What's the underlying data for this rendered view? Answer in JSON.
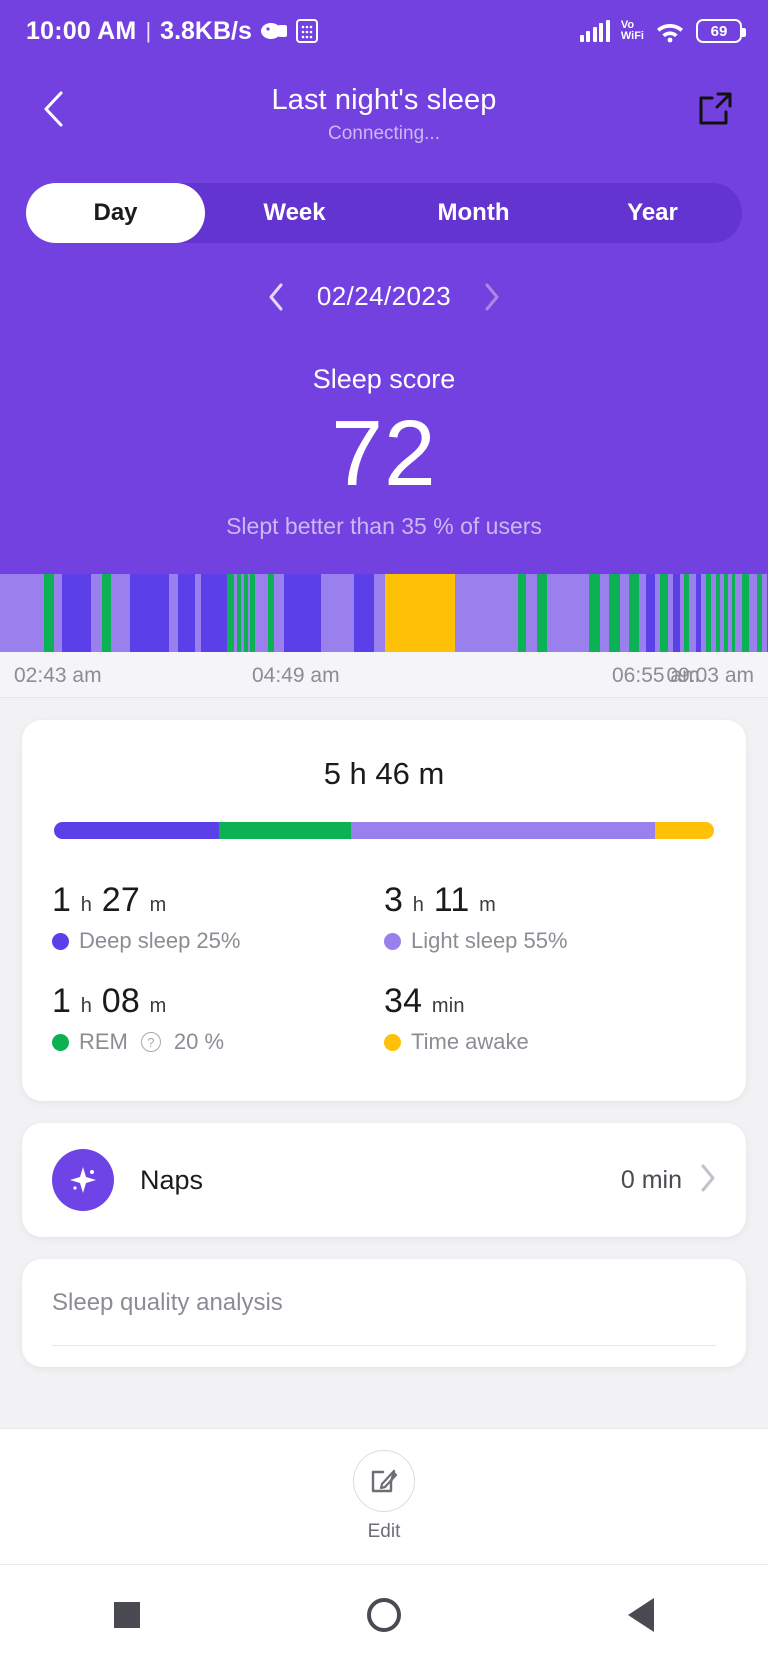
{
  "status_bar": {
    "time": "10:00 AM",
    "separator": "|",
    "network_speed": "3.8KB/s",
    "volte_line1": "Vo",
    "volte_line2": "WiFi",
    "battery_percent": "69"
  },
  "header": {
    "title": "Last night's sleep",
    "subtitle": "Connecting..."
  },
  "tabs": [
    {
      "label": "Day",
      "active": true
    },
    {
      "label": "Week",
      "active": false
    },
    {
      "label": "Month",
      "active": false
    },
    {
      "label": "Year",
      "active": false
    }
  ],
  "date_nav": {
    "prev": "‹",
    "date": "02/24/2023",
    "next": "›"
  },
  "score": {
    "label": "Sleep score",
    "value": "72",
    "comparison": "Slept better than 35 % of users"
  },
  "colors": {
    "header_purple": "#7341e0",
    "tab_track": "#6334cf",
    "deep": "#5b3fe8",
    "rem": "#0bb152",
    "light": "#9a80ec",
    "awake": "#ffc107",
    "text_muted": "#8c8c94"
  },
  "hypnogram": {
    "time_labels": [
      "02:43 am",
      "04:49 am",
      "06:55 am",
      "09:03 am"
    ],
    "segments": [
      {
        "stage": "light",
        "width": 5.2
      },
      {
        "stage": "rem",
        "width": 1.1
      },
      {
        "stage": "light",
        "width": 1.0
      },
      {
        "stage": "deep",
        "width": 3.4
      },
      {
        "stage": "light",
        "width": 1.3
      },
      {
        "stage": "rem",
        "width": 1.1
      },
      {
        "stage": "light",
        "width": 2.2
      },
      {
        "stage": "deep",
        "width": 4.6
      },
      {
        "stage": "light",
        "width": 1.0
      },
      {
        "stage": "deep",
        "width": 2.1
      },
      {
        "stage": "light",
        "width": 0.7
      },
      {
        "stage": "deep",
        "width": 3.0
      },
      {
        "stage": "rem",
        "width": 0.8
      },
      {
        "stage": "light",
        "width": 0.4
      },
      {
        "stage": "rem",
        "width": 0.5
      },
      {
        "stage": "light",
        "width": 0.3
      },
      {
        "stage": "rem",
        "width": 0.5
      },
      {
        "stage": "light",
        "width": 0.3
      },
      {
        "stage": "rem",
        "width": 0.5
      },
      {
        "stage": "light",
        "width": 1.6
      },
      {
        "stage": "rem",
        "width": 0.7
      },
      {
        "stage": "light",
        "width": 1.2
      },
      {
        "stage": "deep",
        "width": 4.3
      },
      {
        "stage": "light",
        "width": 3.9
      },
      {
        "stage": "deep",
        "width": 2.4
      },
      {
        "stage": "light",
        "width": 1.2
      },
      {
        "stage": "awake",
        "width": 8.3
      },
      {
        "stage": "light",
        "width": 7.4
      },
      {
        "stage": "rem",
        "width": 1.0
      },
      {
        "stage": "light",
        "width": 1.2
      },
      {
        "stage": "rem",
        "width": 1.2
      },
      {
        "stage": "light",
        "width": 5.0
      },
      {
        "stage": "rem",
        "width": 1.2
      },
      {
        "stage": "light",
        "width": 1.1
      },
      {
        "stage": "rem",
        "width": 1.3
      },
      {
        "stage": "light",
        "width": 1.1
      },
      {
        "stage": "rem",
        "width": 1.2
      },
      {
        "stage": "light",
        "width": 0.8
      },
      {
        "stage": "deep",
        "width": 1.0
      },
      {
        "stage": "light",
        "width": 0.6
      },
      {
        "stage": "rem",
        "width": 1.0
      },
      {
        "stage": "light",
        "width": 0.6
      },
      {
        "stage": "deep",
        "width": 0.8
      },
      {
        "stage": "light",
        "width": 0.5
      },
      {
        "stage": "rem",
        "width": 0.6
      },
      {
        "stage": "light",
        "width": 0.8
      },
      {
        "stage": "deep",
        "width": 0.6
      },
      {
        "stage": "light",
        "width": 0.6
      },
      {
        "stage": "rem",
        "width": 0.5
      },
      {
        "stage": "light",
        "width": 0.6
      },
      {
        "stage": "rem",
        "width": 0.5
      },
      {
        "stage": "light",
        "width": 0.5
      },
      {
        "stage": "rem",
        "width": 0.4
      },
      {
        "stage": "light",
        "width": 0.5
      },
      {
        "stage": "rem",
        "width": 0.4
      },
      {
        "stage": "light",
        "width": 0.8
      },
      {
        "stage": "rem",
        "width": 0.8
      },
      {
        "stage": "light",
        "width": 1.0
      },
      {
        "stage": "rem",
        "width": 0.5
      },
      {
        "stage": "light",
        "width": 0.7
      }
    ]
  },
  "duration_card": {
    "total": "5 h 46 m",
    "stack": [
      {
        "stage": "deep",
        "percent": 25
      },
      {
        "stage": "rem",
        "percent": 20
      },
      {
        "stage": "light",
        "percent": 46
      },
      {
        "stage": "awake",
        "percent": 9
      }
    ],
    "stats": [
      {
        "value_num1": "1",
        "value_unit1": "h",
        "value_num2": "27",
        "value_unit2": "m",
        "legend": "Deep sleep 25%",
        "dot_color": "#5b3fe8",
        "has_question": false
      },
      {
        "value_num1": "3",
        "value_unit1": "h",
        "value_num2": "11",
        "value_unit2": "m",
        "legend": "Light sleep 55%",
        "dot_color": "#9a80ec",
        "has_question": false
      },
      {
        "value_num1": "1",
        "value_unit1": "h",
        "value_num2": "08",
        "value_unit2": "m",
        "legend_before": "REM",
        "legend_after": "20 %",
        "dot_color": "#0bb152",
        "has_question": true
      },
      {
        "value_num1": "34",
        "value_unit1": "min",
        "value_num2": "",
        "value_unit2": "",
        "legend": "Time awake",
        "dot_color": "#ffc107",
        "has_question": false
      }
    ]
  },
  "naps": {
    "label": "Naps",
    "value": "0 min",
    "chevron": "›"
  },
  "quality": {
    "title": "Sleep quality analysis"
  },
  "edit_bar": {
    "label": "Edit"
  }
}
